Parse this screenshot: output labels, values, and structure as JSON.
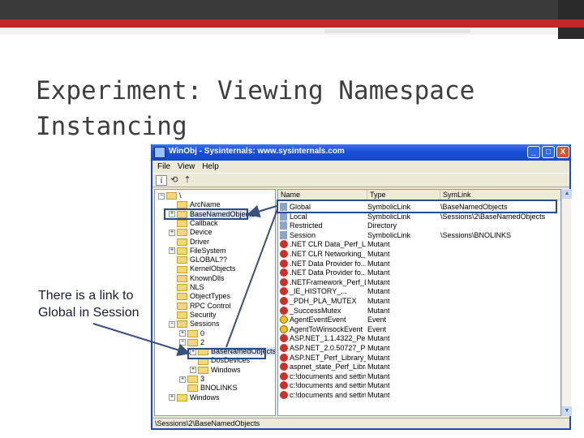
{
  "slide": {
    "title": "Experiment: Viewing Namespace\nInstancing",
    "callout": "There is a link to Global in Session"
  },
  "window": {
    "title": "WinObj - Sysinternals: www.sysinternals.com",
    "minimize": "_",
    "maximize": "□",
    "close": "X",
    "menu": [
      "File",
      "View",
      "Help"
    ],
    "status": "\\Sessions\\2\\BaseNamedObjects"
  },
  "tree": [
    {
      "label": "\\",
      "exp": "−",
      "level": 0
    },
    {
      "label": "ArcName",
      "exp": "",
      "level": 1
    },
    {
      "label": "BaseNamedObjects",
      "exp": "+",
      "level": 1,
      "sel": true
    },
    {
      "label": "Callback",
      "exp": "",
      "level": 1
    },
    {
      "label": "Device",
      "exp": "+",
      "level": 1
    },
    {
      "label": "Driver",
      "exp": "",
      "level": 1
    },
    {
      "label": "FileSystem",
      "exp": "+",
      "level": 1
    },
    {
      "label": "GLOBAL??",
      "exp": "",
      "level": 1
    },
    {
      "label": "KernelObjects",
      "exp": "",
      "level": 1
    },
    {
      "label": "KnownDlls",
      "exp": "",
      "level": 1
    },
    {
      "label": "NLS",
      "exp": "",
      "level": 1
    },
    {
      "label": "ObjectTypes",
      "exp": "",
      "level": 1
    },
    {
      "label": "RPC Control",
      "exp": "",
      "level": 1
    },
    {
      "label": "Security",
      "exp": "",
      "level": 1
    },
    {
      "label": "Sessions",
      "exp": "−",
      "level": 1
    },
    {
      "label": "0",
      "exp": "+",
      "level": 2
    },
    {
      "label": "2",
      "exp": "−",
      "level": 2
    },
    {
      "label": "BaseNamedObjects",
      "exp": "+",
      "level": 3,
      "sel": true
    },
    {
      "label": "DosDevices",
      "exp": "",
      "level": 3
    },
    {
      "label": "Windows",
      "exp": "+",
      "level": 3
    },
    {
      "label": "3",
      "exp": "+",
      "level": 2
    },
    {
      "label": "BNOLINKS",
      "exp": "",
      "level": 2
    },
    {
      "label": "Windows",
      "exp": "+",
      "level": 1
    }
  ],
  "list": {
    "headers": [
      "Name",
      "Type",
      "SymLink"
    ],
    "rows": [
      {
        "icon": "link",
        "name": "Global",
        "type": "SymbolicLink",
        "link": "\\BaseNamedObjects"
      },
      {
        "icon": "link",
        "name": "Local",
        "type": "SymbolicLink",
        "link": "\\Sessions\\2\\BaseNamedObjects"
      },
      {
        "icon": "link",
        "name": "Restricted",
        "type": "Directory",
        "link": ""
      },
      {
        "icon": "link",
        "name": "Session",
        "type": "SymbolicLink",
        "link": "\\Sessions\\BNOLINKS"
      },
      {
        "icon": "mutant",
        "name": ".NET CLR Data_Perf_Li...",
        "type": "Mutant",
        "link": ""
      },
      {
        "icon": "mutant",
        "name": ".NET CLR Networking_...",
        "type": "Mutant",
        "link": ""
      },
      {
        "icon": "mutant",
        "name": ".NET Data Provider fo...",
        "type": "Mutant",
        "link": ""
      },
      {
        "icon": "mutant",
        "name": ".NET Data Provider fo...",
        "type": "Mutant",
        "link": ""
      },
      {
        "icon": "mutant",
        "name": ".NETFramework_Perf_L...",
        "type": "Mutant",
        "link": ""
      },
      {
        "icon": "mutant",
        "name": "_IE_HISTORY_...",
        "type": "Mutant",
        "link": ""
      },
      {
        "icon": "mutant",
        "name": "_PDH_PLA_MUTEX",
        "type": "Mutant",
        "link": ""
      },
      {
        "icon": "mutant",
        "name": "_SuccessMutex",
        "type": "Mutant",
        "link": ""
      },
      {
        "icon": "event",
        "name": "AgentEventEvent",
        "type": "Event",
        "link": ""
      },
      {
        "icon": "event",
        "name": "AgentToWinsockEvent",
        "type": "Event",
        "link": ""
      },
      {
        "icon": "mutant",
        "name": "ASP.NET_1.1.4322_Per...",
        "type": "Mutant",
        "link": ""
      },
      {
        "icon": "mutant",
        "name": "ASP.NET_2.0.50727_Pe...",
        "type": "Mutant",
        "link": ""
      },
      {
        "icon": "mutant",
        "name": "ASP.NET_Perf_Library_",
        "type": "Mutant",
        "link": ""
      },
      {
        "icon": "mutant",
        "name": "aspnet_state_Perf_Library",
        "type": "Mutant",
        "link": ""
      },
      {
        "icon": "mutant",
        "name": "c:!documents and setting...",
        "type": "Mutant",
        "link": ""
      },
      {
        "icon": "mutant",
        "name": "c:!documents and setting...",
        "type": "Mutant",
        "link": ""
      },
      {
        "icon": "mutant",
        "name": "c:!documents and setting...",
        "type": "Mutant",
        "link": ""
      }
    ]
  },
  "colors": {
    "accent": "#c0272d",
    "titlebar": "#1a50d8",
    "highlight": "#2a4d88"
  }
}
